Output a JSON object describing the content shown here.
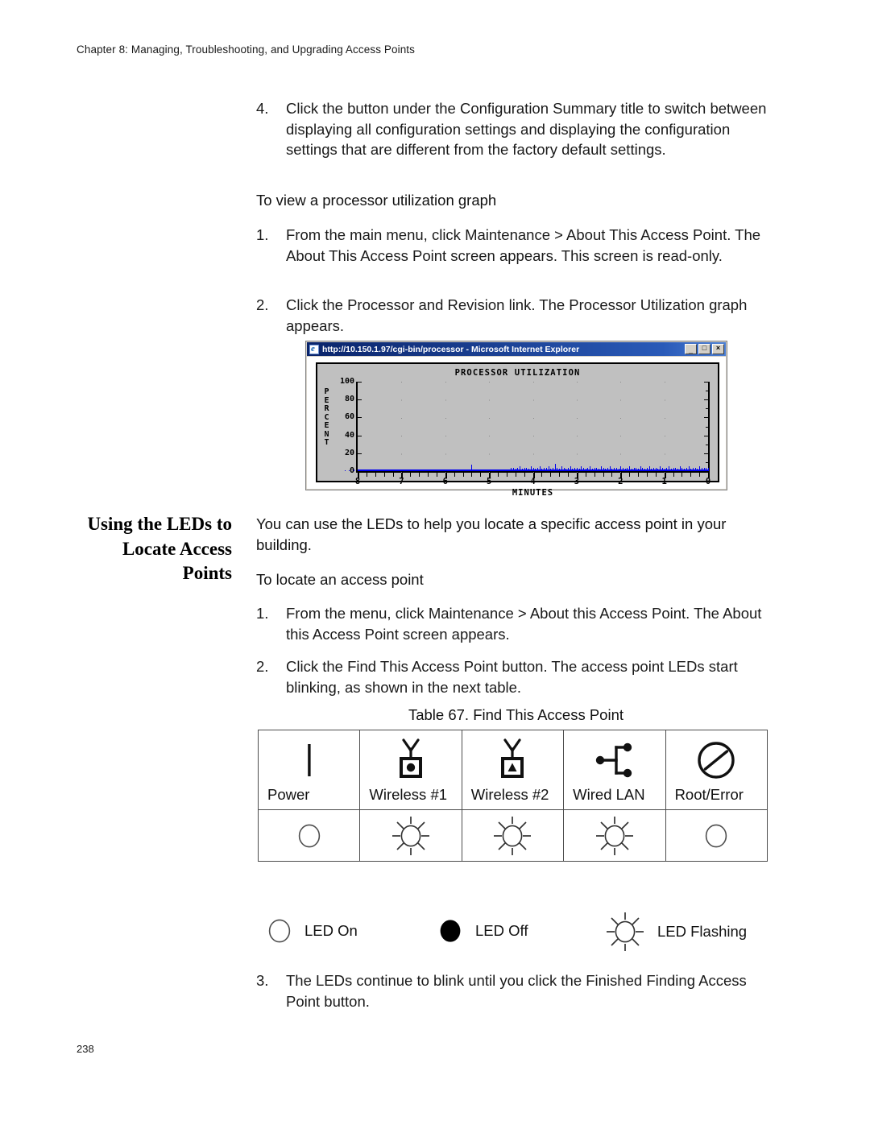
{
  "page": {
    "running_header": "Chapter 8: Managing, Troubleshooting, and Upgrading Access Points",
    "page_number": "238"
  },
  "content": {
    "step4": {
      "num": "4.",
      "text": "Click the button under the Configuration Summary title to switch between displaying all configuration settings and displaying the configuration settings that are different from the factory default settings."
    },
    "intro_graph": "To view a processor utilization graph",
    "step_g1": {
      "num": "1.",
      "text": "From the main menu, click Maintenance > About This Access Point. The About This Access Point screen appears. This screen is read-only."
    },
    "step_g2": {
      "num": "2.",
      "text": "Click the Processor and Revision link. The Processor Utilization graph appears."
    },
    "section_heading": "Using the LEDs to Locate Access Points",
    "section_body": "You can use the LEDs to help you locate a specific access point in your building.",
    "intro_locate": "To locate an access point",
    "step_l1": {
      "num": "1.",
      "text": "From the menu, click Maintenance > About this Access Point. The About this Access Point screen appears."
    },
    "step_l2": {
      "num": "2.",
      "text": "Click the Find This Access Point button. The access point LEDs start blinking, as shown in the next table."
    },
    "step_l3": {
      "num": "3.",
      "text": "The LEDs continue to blink until you click the Finished Finding Access Point button."
    },
    "table_caption": "Table 67. Find This Access Point"
  },
  "browser_window": {
    "title": "http://10.150.1.97/cgi-bin/processor - Microsoft Internet Explorer",
    "favicon": "ie-icon",
    "buttons": {
      "minimize": "_",
      "maximize": "□",
      "close": "×"
    }
  },
  "chart_data": {
    "type": "line",
    "title": "PROCESSOR UTILIZATION",
    "xlabel": "MINUTES",
    "ylabel": "PERCENT",
    "xlim": [
      8,
      0
    ],
    "ylim": [
      0,
      100
    ],
    "ytick_labels": [
      "100",
      "80",
      "60",
      "40",
      "20",
      "0"
    ],
    "ytick_values": [
      100,
      80,
      60,
      40,
      20,
      0
    ],
    "xtick_labels": [
      "8",
      "7",
      "6",
      "5",
      "4",
      "3",
      "2",
      "1",
      "0"
    ],
    "xtick_values": [
      8,
      7,
      6,
      5,
      4,
      3,
      2,
      1,
      0
    ],
    "grid": "dotted-columns",
    "legend": "none",
    "series_color": "#0000ee",
    "background_color": "#c0c0c0",
    "series": [
      {
        "name": "Processor utilization",
        "x": [
          8.3,
          8.2,
          8.1,
          8.0,
          7.9,
          7.8,
          7.7,
          7.6,
          7.5,
          7.4,
          7.3,
          7.2,
          7.1,
          7.0,
          6.9,
          6.8,
          6.7,
          6.6,
          6.5,
          6.4,
          6.3,
          6.2,
          6.1,
          6.0,
          5.9,
          5.8,
          5.7,
          5.6,
          5.5,
          5.45,
          5.4,
          5.35,
          5.3,
          5.2,
          5.1,
          5.0,
          4.9,
          4.8,
          4.7,
          4.6,
          4.55,
          4.5,
          4.45,
          4.4,
          4.35,
          4.3,
          4.25,
          4.2,
          4.15,
          4.1,
          4.05,
          4.0,
          3.95,
          3.9,
          3.85,
          3.8,
          3.75,
          3.7,
          3.65,
          3.6,
          3.55,
          3.5,
          3.45,
          3.4,
          3.35,
          3.3,
          3.25,
          3.2,
          3.15,
          3.1,
          3.05,
          3.0,
          2.95,
          2.9,
          2.85,
          2.8,
          2.75,
          2.7,
          2.65,
          2.6,
          2.55,
          2.5,
          2.45,
          2.4,
          2.35,
          2.3,
          2.25,
          2.2,
          2.15,
          2.1,
          2.05,
          2.0,
          1.95,
          1.9,
          1.85,
          1.8,
          1.75,
          1.7,
          1.65,
          1.6,
          1.55,
          1.5,
          1.45,
          1.4,
          1.35,
          1.3,
          1.25,
          1.2,
          1.15,
          1.1,
          1.05,
          1.0,
          0.95,
          0.9,
          0.85,
          0.8,
          0.75,
          0.7,
          0.65,
          0.6,
          0.55,
          0.5,
          0.45,
          0.4,
          0.35,
          0.3,
          0.25,
          0.2,
          0.15,
          0.1,
          0.05,
          0.0
        ],
        "y": [
          1,
          1,
          2,
          1,
          1,
          2,
          1,
          1,
          1,
          2,
          1,
          1,
          2,
          1,
          1,
          1,
          2,
          1,
          1,
          2,
          1,
          1,
          1,
          2,
          1,
          1,
          2,
          1,
          1,
          2,
          7,
          2,
          1,
          1,
          1,
          2,
          1,
          1,
          2,
          1,
          1,
          4,
          4,
          3,
          4,
          5,
          3,
          4,
          4,
          3,
          5,
          4,
          3,
          4,
          5,
          3,
          4,
          4,
          5,
          3,
          4,
          8,
          4,
          3,
          5,
          4,
          3,
          4,
          5,
          3,
          4,
          4,
          3,
          5,
          4,
          3,
          4,
          5,
          3,
          4,
          4,
          3,
          5,
          4,
          3,
          4,
          5,
          3,
          4,
          4,
          3,
          5,
          4,
          3,
          4,
          5,
          3,
          4,
          4,
          3,
          5,
          4,
          3,
          4,
          5,
          3,
          4,
          4,
          3,
          5,
          4,
          3,
          4,
          5,
          3,
          4,
          4,
          3,
          5,
          4,
          3,
          4,
          5,
          3,
          4,
          4,
          3,
          5,
          4,
          4,
          4,
          4
        ]
      }
    ]
  },
  "led_table": {
    "columns": [
      {
        "label": "Power",
        "icon": "power-bar-icon",
        "state": "led-on-icon"
      },
      {
        "label": "Wireless #1",
        "icon": "wireless-antenna-circle-icon",
        "state": "led-flashing-icon"
      },
      {
        "label": "Wireless #2",
        "icon": "wireless-antenna-triangle-icon",
        "state": "led-flashing-icon"
      },
      {
        "label": "Wired LAN",
        "icon": "wired-lan-icon",
        "state": "led-flashing-icon"
      },
      {
        "label": "Root/Error",
        "icon": "root-error-icon",
        "state": "led-on-icon"
      }
    ]
  },
  "legend": [
    {
      "icon": "led-on-icon",
      "label": "LED On"
    },
    {
      "icon": "led-off-icon",
      "label": "LED Off"
    },
    {
      "icon": "led-flashing-icon",
      "label": "LED Flashing"
    }
  ]
}
